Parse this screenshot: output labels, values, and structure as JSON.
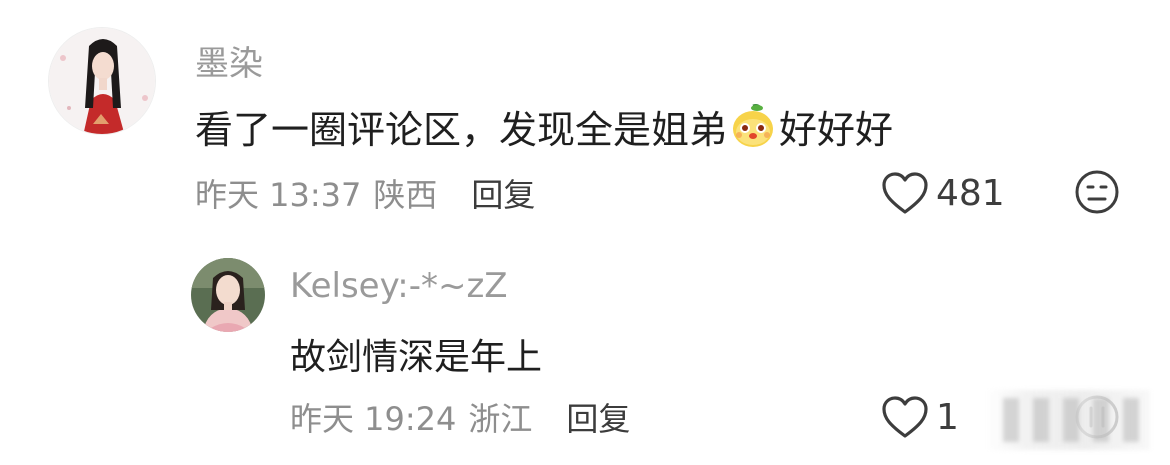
{
  "comments": [
    {
      "author": "墨染",
      "text_before": "看了一圈评论区，发现全是姐弟",
      "emoji": "mango-face-emoji",
      "text_after": "好好好",
      "time": "昨天 13:37",
      "location": "陕西",
      "reply_label": "回复",
      "likes": "481",
      "reaction_icon": "neutral-face-icon"
    },
    {
      "author": "Kelsey:-*~zZ",
      "text": "故剑情深是年上",
      "time": "昨天 19:24",
      "location": "浙江",
      "reply_label": "回复",
      "likes": "1",
      "reaction_icon": "reaction-icon"
    }
  ],
  "colors": {
    "author": "#9a9a9a",
    "text": "#1f1f1f",
    "meta": "#8e8e8e",
    "reply": "#3c3c3c"
  }
}
